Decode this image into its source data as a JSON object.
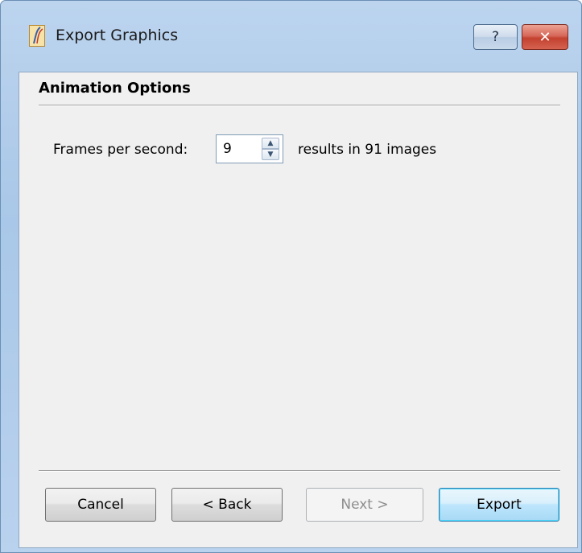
{
  "window": {
    "title": "Export Graphics",
    "help_label": "?",
    "close_label": "✕"
  },
  "page": {
    "title": "Animation Options"
  },
  "frames": {
    "label": "Frames per second:",
    "value": "9",
    "result": "results in 91 images",
    "up_glyph": "▲",
    "down_glyph": "▼"
  },
  "buttons": {
    "cancel": "Cancel",
    "back": "< Back",
    "next": "Next >",
    "export": "Export"
  }
}
